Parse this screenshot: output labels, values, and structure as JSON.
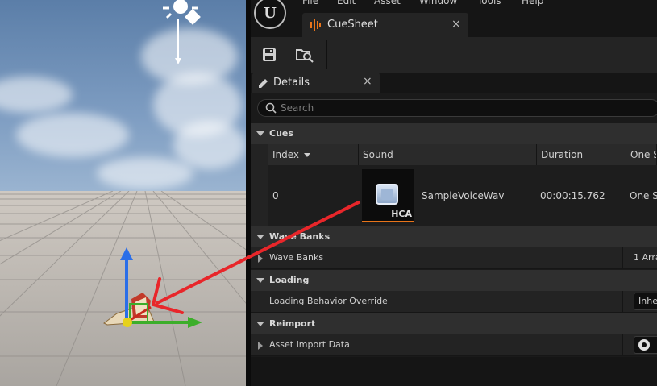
{
  "menu": [
    "File",
    "Edit",
    "Asset",
    "Window",
    "Tools",
    "Help"
  ],
  "asset_tab": {
    "label": "CueSheet",
    "close": "×"
  },
  "details_tab": {
    "label": "Details",
    "close": "×"
  },
  "search": {
    "placeholder": "Search"
  },
  "sections": {
    "cues": "Cues",
    "wave_banks": "Wave Banks",
    "loading": "Loading",
    "reimport": "Reimport"
  },
  "cue_table": {
    "headers": [
      "Index",
      "Sound",
      "Duration",
      "One S"
    ],
    "rows": [
      {
        "index": "0",
        "sound": "SampleVoiceWav",
        "thumb_badge": "HCA",
        "duration": "00:00:15.762",
        "one_shot": "One S"
      }
    ]
  },
  "properties": {
    "wave_banks_label": "Wave Banks",
    "wave_banks_value": "1 Arra",
    "loading_override_label": "Loading Behavior Override",
    "loading_override_value": "Inhe",
    "asset_import_label": "Asset Import Data"
  },
  "colors": {
    "annotation_arrow": "#e8262a",
    "accent_bar": "#e8741a",
    "panel_bg": "#1a1a1a"
  },
  "icons": [
    "unreal-logo-icon",
    "cuesheet-icon",
    "save-icon",
    "browse-icon",
    "details-icon",
    "search-icon",
    "sun-icon",
    "transform-gizmo-icon"
  ]
}
